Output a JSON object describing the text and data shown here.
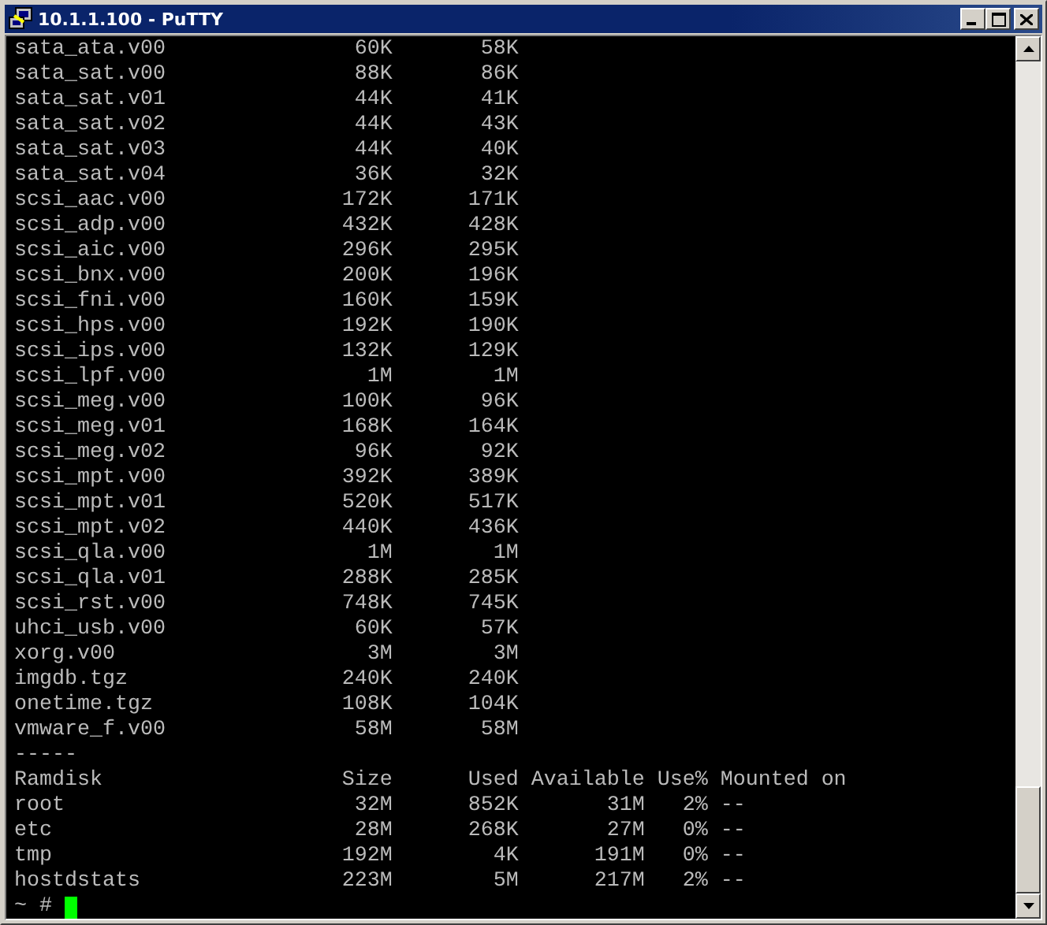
{
  "window": {
    "title": "10.1.1.100 - PuTTY"
  },
  "files": [
    {
      "name": "sata_ata.v00",
      "size": "60K",
      "used": "58K"
    },
    {
      "name": "sata_sat.v00",
      "size": "88K",
      "used": "86K"
    },
    {
      "name": "sata_sat.v01",
      "size": "44K",
      "used": "41K"
    },
    {
      "name": "sata_sat.v02",
      "size": "44K",
      "used": "43K"
    },
    {
      "name": "sata_sat.v03",
      "size": "44K",
      "used": "40K"
    },
    {
      "name": "sata_sat.v04",
      "size": "36K",
      "used": "32K"
    },
    {
      "name": "scsi_aac.v00",
      "size": "172K",
      "used": "171K"
    },
    {
      "name": "scsi_adp.v00",
      "size": "432K",
      "used": "428K"
    },
    {
      "name": "scsi_aic.v00",
      "size": "296K",
      "used": "295K"
    },
    {
      "name": "scsi_bnx.v00",
      "size": "200K",
      "used": "196K"
    },
    {
      "name": "scsi_fni.v00",
      "size": "160K",
      "used": "159K"
    },
    {
      "name": "scsi_hps.v00",
      "size": "192K",
      "used": "190K"
    },
    {
      "name": "scsi_ips.v00",
      "size": "132K",
      "used": "129K"
    },
    {
      "name": "scsi_lpf.v00",
      "size": "1M",
      "used": "1M"
    },
    {
      "name": "scsi_meg.v00",
      "size": "100K",
      "used": "96K"
    },
    {
      "name": "scsi_meg.v01",
      "size": "168K",
      "used": "164K"
    },
    {
      "name": "scsi_meg.v02",
      "size": "96K",
      "used": "92K"
    },
    {
      "name": "scsi_mpt.v00",
      "size": "392K",
      "used": "389K"
    },
    {
      "name": "scsi_mpt.v01",
      "size": "520K",
      "used": "517K"
    },
    {
      "name": "scsi_mpt.v02",
      "size": "440K",
      "used": "436K"
    },
    {
      "name": "scsi_qla.v00",
      "size": "1M",
      "used": "1M"
    },
    {
      "name": "scsi_qla.v01",
      "size": "288K",
      "used": "285K"
    },
    {
      "name": "scsi_rst.v00",
      "size": "748K",
      "used": "745K"
    },
    {
      "name": "uhci_usb.v00",
      "size": "60K",
      "used": "57K"
    },
    {
      "name": "xorg.v00",
      "size": "3M",
      "used": "3M"
    },
    {
      "name": "imgdb.tgz",
      "size": "240K",
      "used": "240K"
    },
    {
      "name": "onetime.tgz",
      "size": "108K",
      "used": "104K"
    },
    {
      "name": "vmware_f.v00",
      "size": "58M",
      "used": "58M"
    }
  ],
  "separator": "-----",
  "ramdisk": {
    "columns": [
      "Ramdisk",
      "Size",
      "Used",
      "Available",
      "Use%",
      "Mounted on"
    ],
    "rows": [
      [
        "root",
        "32M",
        "852K",
        "31M",
        "2%",
        "--"
      ],
      [
        "etc",
        "28M",
        "268K",
        "27M",
        "0%",
        "--"
      ],
      [
        "tmp",
        "192M",
        "4K",
        "191M",
        "0%",
        "--"
      ],
      [
        "hostdstats",
        "223M",
        "5M",
        "217M",
        "2%",
        "--"
      ]
    ]
  },
  "prompt": "~ #"
}
